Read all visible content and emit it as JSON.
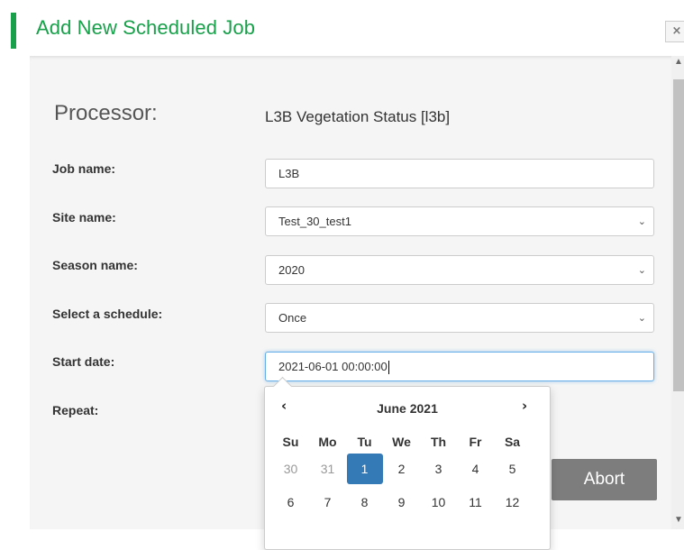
{
  "dialog": {
    "title": "Add New Scheduled Job",
    "close_glyph": "×"
  },
  "processor": {
    "label": "Processor:",
    "value": "L3B Vegetation Status [l3b]"
  },
  "fields": {
    "job_name": {
      "label": "Job name:",
      "value": "L3B"
    },
    "site_name": {
      "label": "Site name:",
      "value": "Test_30_test1"
    },
    "season_name": {
      "label": "Season name:",
      "value": "2020"
    },
    "schedule": {
      "label": "Select a schedule:",
      "value": "Once"
    },
    "start_date": {
      "label": "Start date:",
      "value": "2021-06-01 00:00:00"
    },
    "repeat": {
      "label": "Repeat:"
    }
  },
  "buttons": {
    "abort": "Abort"
  },
  "datepicker": {
    "month_label": "June 2021",
    "prev_glyph": "‹",
    "next_glyph": "›",
    "weekdays": [
      "Su",
      "Mo",
      "Tu",
      "We",
      "Th",
      "Fr",
      "Sa"
    ],
    "weeks": [
      [
        "30",
        "31",
        "1",
        "2",
        "3",
        "4",
        "5"
      ],
      [
        "6",
        "7",
        "8",
        "9",
        "10",
        "11",
        "12"
      ]
    ],
    "selected_day": "1"
  },
  "colors": {
    "accent": "#19a04b",
    "selected": "#337ab7",
    "abort_bg": "#7d7d7d"
  },
  "icons": {
    "select_chevron": "chevron-down-icon",
    "close": "close-icon"
  }
}
